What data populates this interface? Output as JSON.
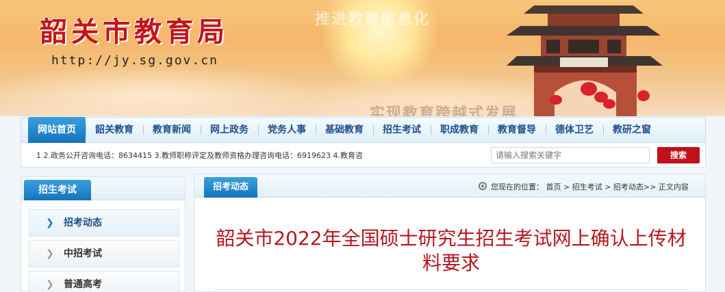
{
  "banner": {
    "site_title": "韶关市教育局",
    "site_url": "http://jy.sg.gov.cn",
    "slogan_top": "推进教育信息化",
    "slogan_bottom": "实现教育跨越式发展"
  },
  "nav": {
    "items": [
      {
        "label": "网站首页",
        "active": true
      },
      {
        "label": "韶关教育"
      },
      {
        "label": "教育新闻"
      },
      {
        "label": "网上政务"
      },
      {
        "label": "党务人事"
      },
      {
        "label": "基础教育"
      },
      {
        "label": "招生考试"
      },
      {
        "label": "职成教育"
      },
      {
        "label": "教育督导"
      },
      {
        "label": "德体卫艺"
      },
      {
        "label": "教研之窗"
      }
    ]
  },
  "ticker": {
    "text": "1 2.政务公开咨询电话：8634415 3.教师职称评定及教师资格办理咨询电话：6919623 4.教育咨"
  },
  "search": {
    "placeholder": "请输入搜索关键字",
    "button_label": "搜索"
  },
  "sidebar": {
    "heading": "招生考试",
    "items": [
      {
        "label": "招考动态",
        "active": true
      },
      {
        "label": "中招考试"
      },
      {
        "label": "普通高考"
      }
    ]
  },
  "main": {
    "tab_label": "招考动态",
    "breadcrumb": "您现在的位置： 首页 > 招生考试 > 招考动态>> 正文内容",
    "article_title": "韶关市2022年全国硕士研究生招生考试网上确认上传材料要求"
  },
  "colors": {
    "accent_blue": "#1474bd",
    "title_red": "#b5161d",
    "search_red": "#c0101a"
  }
}
